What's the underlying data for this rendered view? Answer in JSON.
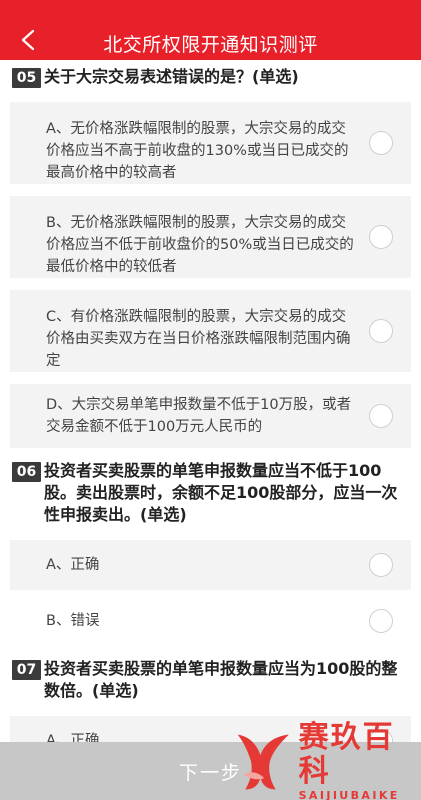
{
  "header": {
    "title": "北交所权限开通知识测评",
    "accent": "#e8202a"
  },
  "questions": [
    {
      "num": "05",
      "text": "关于大宗交易表述错误的是？(单选)",
      "options": [
        "A、无价格涨跌幅限制的股票，大宗交易的成交价格应当不高于前收盘的130%或当日已成交的最高价格中的较高者",
        "B、无价格涨跌幅限制的股票，大宗交易的成交价格应当不低于前收盘价的50%或当日已成交的最低价格中的较低者",
        "C、有价格涨跌幅限制的股票，大宗交易的成交价格由买卖双方在当日价格涨跌幅限制范围内确定",
        "D、大宗交易单笔申报数量不低于10万股，或者交易金额不低于100万元人民币的"
      ]
    },
    {
      "num": "06",
      "text": "投资者买卖股票的单笔申报数量应当不低于100股。卖出股票时，余额不足100股部分，应当一次性申报卖出。(单选)",
      "options": [
        "A、正确",
        "B、错误"
      ]
    },
    {
      "num": "07",
      "text": "投资者买卖股票的单笔申报数量应当为100股的整数倍。(单选)",
      "options": [
        "A、正确"
      ]
    }
  ],
  "footer": {
    "next_label": "下一步"
  },
  "watermark": {
    "cn": "赛玖百科",
    "en": "SAIJIUBAIKE"
  }
}
